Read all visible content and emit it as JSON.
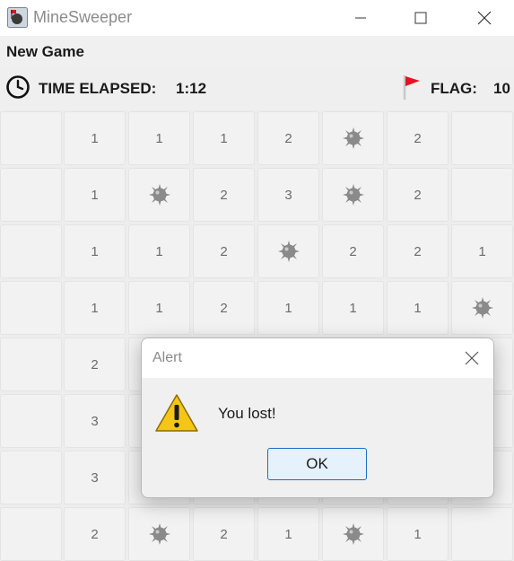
{
  "window": {
    "title": "MineSweeper",
    "icons": {
      "app": "minesweeper-app-icon",
      "minimize": "minimize-icon",
      "maximize": "maximize-icon",
      "close": "close-icon"
    }
  },
  "menu": {
    "new_game": "New Game"
  },
  "status": {
    "time_label": "TIME ELAPSED:",
    "time_value": "1:12",
    "flag_label": "FLAG:",
    "flag_value": "10",
    "icons": {
      "clock": "clock-icon",
      "flag": "red-flag-icon"
    },
    "flag_color": "#e81123"
  },
  "board": {
    "columns": 8,
    "rows": [
      [
        "",
        "1",
        "1",
        "1",
        "2",
        "mine",
        "2",
        ""
      ],
      [
        "",
        "1",
        "mine",
        "2",
        "3",
        "mine",
        "2",
        ""
      ],
      [
        "",
        "1",
        "1",
        "2",
        "mine",
        "2",
        "2",
        "1"
      ],
      [
        "",
        "1",
        "1",
        "2",
        "1",
        "1",
        "1",
        "mine"
      ],
      [
        "",
        "2",
        "",
        "",
        "",
        "",
        "",
        ""
      ],
      [
        "",
        "3",
        "",
        "",
        "",
        "",
        "",
        ""
      ],
      [
        "",
        "3",
        "",
        "",
        "",
        "",
        "",
        ""
      ],
      [
        "",
        "2",
        "mine",
        "2",
        "1",
        "mine",
        "1",
        ""
      ]
    ],
    "mine_icon": "mine-icon",
    "number_color": "#6b6b6b",
    "mine_color": "#8a8a8a"
  },
  "dialog": {
    "title": "Alert",
    "message": "You lost!",
    "ok_label": "OK",
    "icons": {
      "warning": "warning-icon",
      "close": "close-icon"
    },
    "button_accent": "#1a6fc4"
  }
}
